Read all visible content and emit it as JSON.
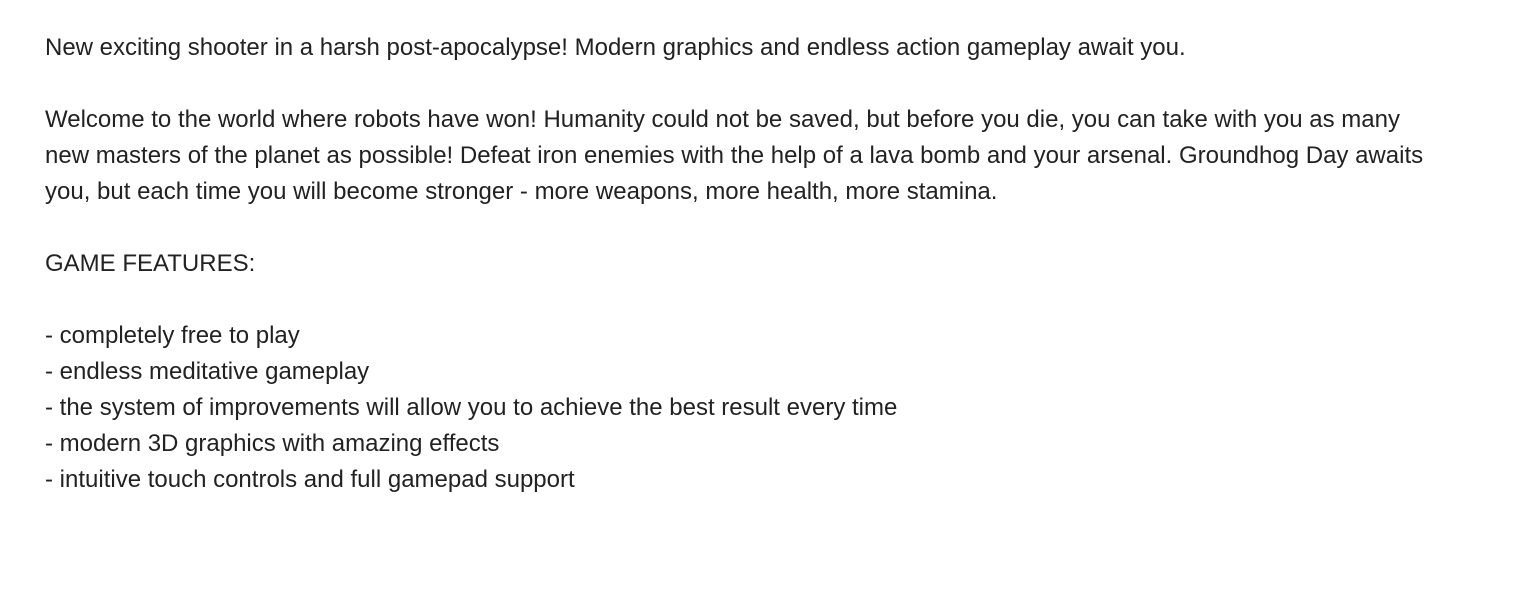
{
  "description": {
    "intro": "New exciting shooter in a harsh post-apocalypse! Modern graphics and endless action gameplay await you.",
    "body": "Welcome to the world where robots have won! Humanity could not be saved, but before you die, you can take with you as many new masters of the planet as possible! Defeat iron enemies with the help of a lava bomb and your arsenal. Groundhog Day awaits you, but each time you will become stronger - more weapons, more health, more stamina.",
    "features_heading": "GAME FEATURES:",
    "features": [
      "- completely free to play",
      "- endless meditative gameplay",
      "- the system of improvements will allow you to achieve the best result every time",
      "- modern 3D graphics with amazing effects",
      "- intuitive touch controls and full gamepad support"
    ]
  }
}
